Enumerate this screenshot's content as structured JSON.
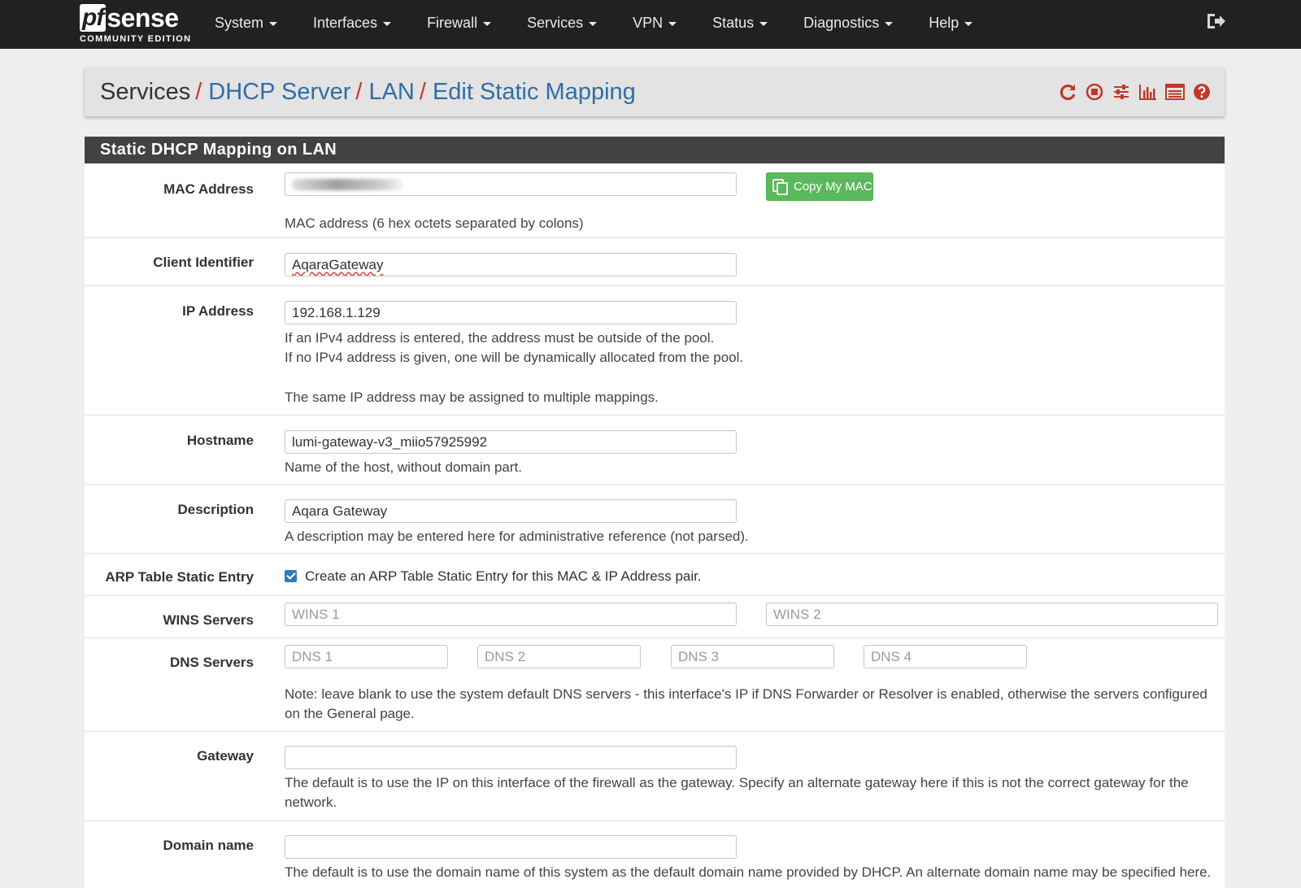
{
  "brand": {
    "logo_pf": "pf",
    "logo_sense": "sense",
    "edition": "COMMUNITY EDITION"
  },
  "nav": {
    "items": [
      {
        "label": "System"
      },
      {
        "label": "Interfaces"
      },
      {
        "label": "Firewall"
      },
      {
        "label": "Services"
      },
      {
        "label": "VPN"
      },
      {
        "label": "Status"
      },
      {
        "label": "Diagnostics"
      },
      {
        "label": "Help"
      }
    ],
    "logout_icon": "logout-icon"
  },
  "breadcrumb": {
    "root": "Services",
    "links": [
      "DHCP Server",
      "LAN",
      "Edit Static Mapping"
    ],
    "separator": "/",
    "icons": [
      "restart-service-icon",
      "stop-service-icon",
      "settings-sliders-icon",
      "bar-chart-icon",
      "log-list-icon",
      "help-icon"
    ]
  },
  "colors": {
    "accent_red": "#c0392b",
    "link_blue": "#2f6ea6",
    "nav_bg": "#212121",
    "panel_heading_bg": "#424242",
    "success_green": "#5cb85c",
    "checkbox_blue": "#337ab7"
  },
  "panel": {
    "title": "Static DHCP Mapping on LAN",
    "mac": {
      "label": "MAC Address",
      "value_redacted": true,
      "copy_button": "Copy My MAC",
      "help": "MAC address (6 hex octets separated by colons)"
    },
    "client_id": {
      "label": "Client Identifier",
      "value": "AqaraGateway"
    },
    "ip": {
      "label": "IP Address",
      "value": "192.168.1.129",
      "help1": "If an IPv4 address is entered, the address must be outside of the pool.",
      "help2": "If no IPv4 address is given, one will be dynamically allocated from the pool.",
      "help3": "The same IP address may be assigned to multiple mappings."
    },
    "hostname": {
      "label": "Hostname",
      "value": "lumi-gateway-v3_miio57925992",
      "help": "Name of the host, without domain part."
    },
    "description": {
      "label": "Description",
      "value": "Aqara Gateway",
      "help": "A description may be entered here for administrative reference (not parsed)."
    },
    "arp": {
      "label": "ARP Table Static Entry",
      "checked": true,
      "text": "Create an ARP Table Static Entry for this MAC & IP Address pair."
    },
    "wins": {
      "label": "WINS Servers",
      "placeholder1": "WINS 1",
      "placeholder2": "WINS 2"
    },
    "dns": {
      "label": "DNS Servers",
      "placeholders": [
        "DNS 1",
        "DNS 2",
        "DNS 3",
        "DNS 4"
      ],
      "help": "Note: leave blank to use the system default DNS servers - this interface's IP if DNS Forwarder or Resolver is enabled, otherwise the servers configured on the General page."
    },
    "gateway": {
      "label": "Gateway",
      "value": "",
      "help": "The default is to use the IP on this interface of the firewall as the gateway. Specify an alternate gateway here if this is not the correct gateway for the network."
    },
    "domain": {
      "label": "Domain name",
      "value": "",
      "help": "The default is to use the domain name of this system as the default domain name provided by DHCP. An alternate domain name may be specified here."
    }
  }
}
